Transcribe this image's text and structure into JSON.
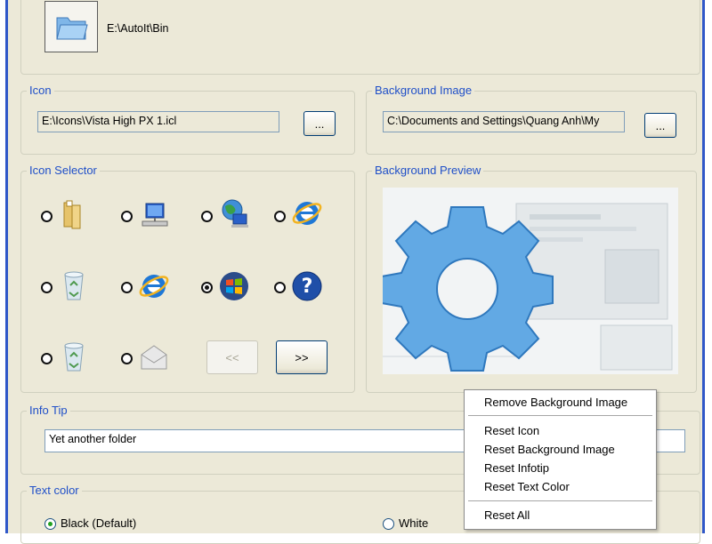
{
  "folder": {
    "path": "E:\\AutoIt\\Bin",
    "icon": "folder-icon"
  },
  "icon_group": {
    "label": "Icon",
    "path": "E:\\Icons\\Vista High PX 1.icl",
    "browse_label": "..."
  },
  "background_group": {
    "label": "Background Image",
    "path": "C:\\Documents and Settings\\Quang Anh\\My",
    "browse_label": "..."
  },
  "icon_selector": {
    "label": "Icon Selector",
    "icons": [
      {
        "icon": "folder-icon",
        "selected": false
      },
      {
        "icon": "network-computer-icon",
        "selected": false
      },
      {
        "icon": "network-globe-icon",
        "selected": false
      },
      {
        "icon": "internet-explorer-icon",
        "selected": false
      },
      {
        "icon": "recycle-bin-icon",
        "selected": false
      },
      {
        "icon": "internet-explorer-icon",
        "selected": false
      },
      {
        "icon": "windows-orb-icon",
        "selected": true
      },
      {
        "icon": "help-icon",
        "selected": false
      },
      {
        "icon": "recycle-bin-icon",
        "selected": false
      },
      {
        "icon": "envelope-icon",
        "selected": false
      }
    ],
    "prev_label": "<<",
    "next_label": ">>"
  },
  "background_preview": {
    "label": "Background Preview"
  },
  "info_tip": {
    "label": "Info Tip",
    "value": "Yet another folder"
  },
  "text_color": {
    "label": "Text color",
    "options": [
      {
        "label": "Black (Default)",
        "selected": true
      },
      {
        "label": "White",
        "selected": false
      }
    ]
  },
  "context_menu": {
    "items": [
      "Remove Background Image",
      "Reset Icon",
      "Reset Background Image",
      "Reset Infotip",
      "Reset Text Color",
      "Reset All"
    ]
  }
}
